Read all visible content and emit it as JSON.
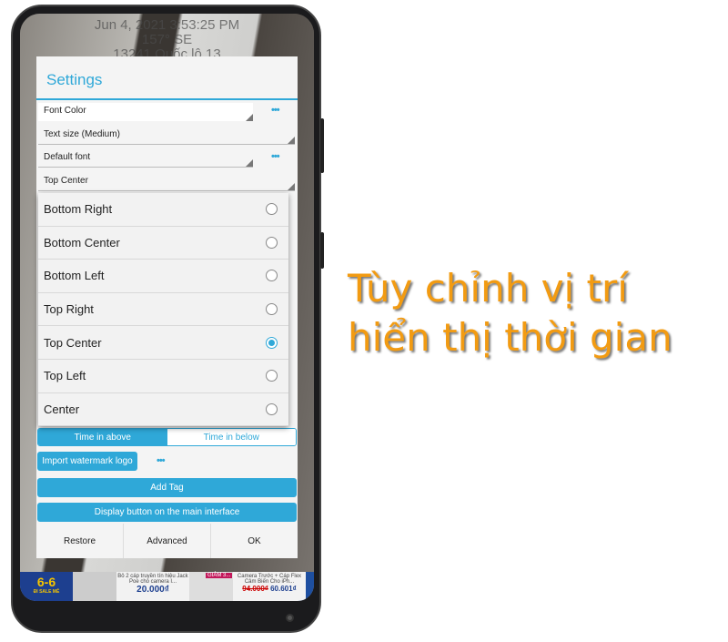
{
  "camera_overlay": {
    "datetime": "Jun 4, 2021 3:53:25 PM",
    "heading": "157° SE",
    "address": "13241 Quốc lộ 13"
  },
  "dialog": {
    "title": "Settings",
    "rows": [
      {
        "label": "Font Color"
      },
      {
        "label": "Text size (Medium)"
      },
      {
        "label": "Default font"
      },
      {
        "label": "Top Center"
      }
    ],
    "more_label": "•••",
    "position_options": [
      {
        "label": "Bottom Right",
        "selected": false
      },
      {
        "label": "Bottom Center",
        "selected": false
      },
      {
        "label": "Bottom Left",
        "selected": false
      },
      {
        "label": "Top Right",
        "selected": false
      },
      {
        "label": "Top Center",
        "selected": true
      },
      {
        "label": "Top Left",
        "selected": false
      },
      {
        "label": "Center",
        "selected": false
      }
    ],
    "time_toggle": {
      "above": "Time in above",
      "below": "Time in below",
      "active": "above"
    },
    "import_logo": "Import watermark logo",
    "add_tag": "Add Tag",
    "display_button": "Display button on the main interface",
    "footer": {
      "restore": "Restore",
      "advanced": "Advanced",
      "ok": "OK"
    },
    "accent": "#2fa8d8"
  },
  "ad_banner": {
    "promo": "6-6",
    "promo_sub": "ĐI SALE MÊ",
    "item1": "Bô 2 cáp truyền tín hiệu Jack Poe cho camera I...",
    "price1": "20.000₫",
    "badge2": "GIẢM 3...",
    "item2": "Camera Trước + Cáp Flex Cảm Biến Cho iPh...",
    "old_price2": "94.000₫",
    "price2": "60.601₫"
  },
  "caption": {
    "line1": "Tùy chỉnh vị trí",
    "line2": "hiển thị thời gian",
    "color": "#f29b12"
  }
}
